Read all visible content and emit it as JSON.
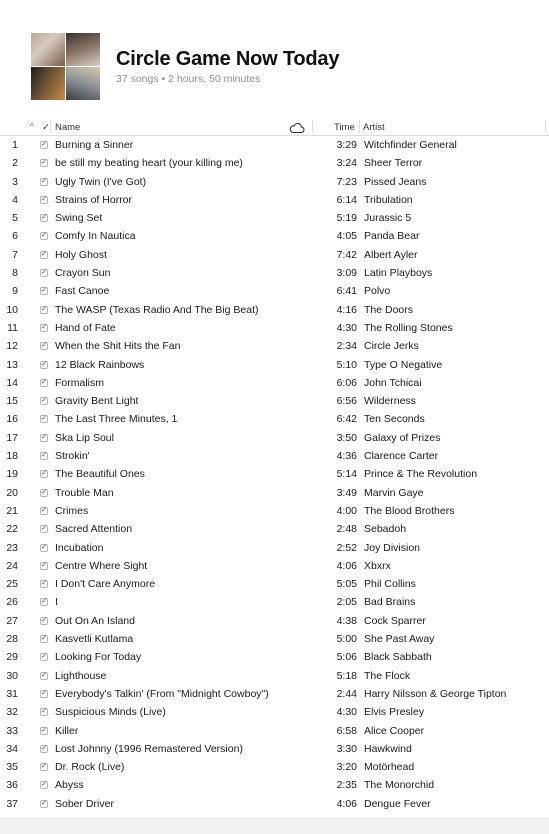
{
  "playlist": {
    "title": "Circle Game Now Today",
    "meta": "37 songs • 2 hours, 50 minutes"
  },
  "columns": {
    "sort_indicator": "^",
    "check": "✓",
    "name": "Name",
    "cloud_icon": "cloud-icon",
    "time": "Time",
    "artist": "Artist"
  },
  "songs": [
    {
      "num": "1",
      "name": "Burning a Sinner",
      "time": "3:29",
      "artist": "Witchfinder General"
    },
    {
      "num": "2",
      "name": "be still my beating heart (your killing me)",
      "time": "3:24",
      "artist": "Sheer Terror"
    },
    {
      "num": "3",
      "name": "Ugly Twin (I've Got)",
      "time": "7:23",
      "artist": "Pissed Jeans"
    },
    {
      "num": "4",
      "name": "Strains of Horror",
      "time": "6:14",
      "artist": "Tribulation"
    },
    {
      "num": "5",
      "name": "Swing Set",
      "time": "5:19",
      "artist": "Jurassic 5"
    },
    {
      "num": "6",
      "name": "Comfy In Nautica",
      "time": "4:05",
      "artist": "Panda Bear"
    },
    {
      "num": "7",
      "name": "Holy Ghost",
      "time": "7:42",
      "artist": "Albert Ayler"
    },
    {
      "num": "8",
      "name": "Crayon Sun",
      "time": "3:09",
      "artist": "Latin Playboys"
    },
    {
      "num": "9",
      "name": "Fast Canoe",
      "time": "6:41",
      "artist": "Polvo"
    },
    {
      "num": "10",
      "name": "The WASP (Texas Radio And The Big Beat)",
      "time": "4:16",
      "artist": "The Doors"
    },
    {
      "num": "11",
      "name": "Hand of Fate",
      "time": "4:30",
      "artist": "The Rolling Stones"
    },
    {
      "num": "12",
      "name": "When the Shit Hits the Fan",
      "time": "2:34",
      "artist": "Circle Jerks"
    },
    {
      "num": "13",
      "name": "12 Black Rainbows",
      "time": "5:10",
      "artist": "Type O Negative"
    },
    {
      "num": "14",
      "name": "Formalism",
      "time": "6:06",
      "artist": "John Tchicai"
    },
    {
      "num": "15",
      "name": "Gravity Bent Light",
      "time": "6:56",
      "artist": "Wilderness"
    },
    {
      "num": "16",
      "name": "The Last Three Minutes, 1",
      "time": "6:42",
      "artist": "Ten Seconds"
    },
    {
      "num": "17",
      "name": "Ska Lip Soul",
      "time": "3:50",
      "artist": "Galaxy of Prizes"
    },
    {
      "num": "18",
      "name": "Strokin'",
      "time": "4:36",
      "artist": "Clarence Carter"
    },
    {
      "num": "19",
      "name": "The Beautiful Ones",
      "time": "5:14",
      "artist": "Prince & The Revolution"
    },
    {
      "num": "20",
      "name": "Trouble Man",
      "time": "3:49",
      "artist": "Marvin Gaye"
    },
    {
      "num": "21",
      "name": "Crimes",
      "time": "4:00",
      "artist": "The Blood Brothers"
    },
    {
      "num": "22",
      "name": "Sacred Attention",
      "time": "2:48",
      "artist": "Sebadoh"
    },
    {
      "num": "23",
      "name": "Incubation",
      "time": "2:52",
      "artist": "Joy Division"
    },
    {
      "num": "24",
      "name": "Centre Where Sight",
      "time": "4:06",
      "artist": "Xbxrx"
    },
    {
      "num": "25",
      "name": "I Don't Care Anymore",
      "time": "5:05",
      "artist": "Phil Collins"
    },
    {
      "num": "26",
      "name": "I",
      "time": "2:05",
      "artist": "Bad Brains"
    },
    {
      "num": "27",
      "name": "Out On An Island",
      "time": "4:38",
      "artist": "Cock Sparrer"
    },
    {
      "num": "28",
      "name": "Kasvetli Kutlama",
      "time": "5:00",
      "artist": "She Past Away"
    },
    {
      "num": "29",
      "name": "Looking For Today",
      "time": "5:06",
      "artist": "Black Sabbath"
    },
    {
      "num": "30",
      "name": "Lighthouse",
      "time": "5:18",
      "artist": "The Flock"
    },
    {
      "num": "31",
      "name": "Everybody's Talkin' (From \"Midnight Cowboy\")",
      "time": "2:44",
      "artist": "Harry Nilsson & George Tipton"
    },
    {
      "num": "32",
      "name": "Suspicious Minds (Live)",
      "time": "4:30",
      "artist": "Elvis Presley"
    },
    {
      "num": "33",
      "name": "Killer",
      "time": "6:58",
      "artist": "Alice Cooper"
    },
    {
      "num": "34",
      "name": "Lost Johnny (1996 Remastered Version)",
      "time": "3:30",
      "artist": "Hawkwind"
    },
    {
      "num": "35",
      "name": "Dr. Rock (Live)",
      "time": "3:20",
      "artist": "Motörhead"
    },
    {
      "num": "36",
      "name": "Abyss",
      "time": "2:35",
      "artist": "The Monorchid"
    },
    {
      "num": "37",
      "name": "Sober Driver",
      "time": "4:06",
      "artist": "Dengue Fever"
    }
  ]
}
